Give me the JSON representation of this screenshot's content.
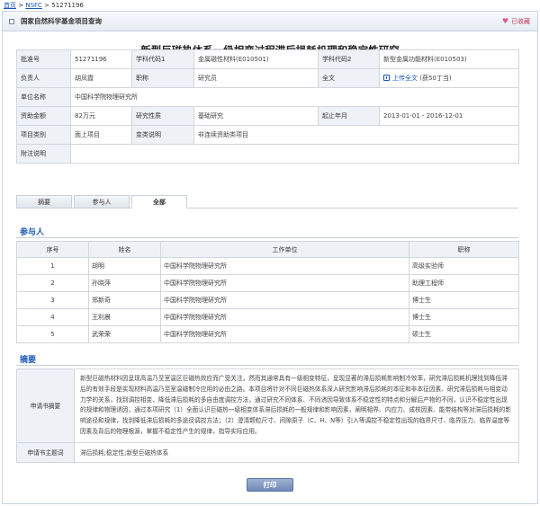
{
  "breadcrumb": {
    "home": "首页",
    "sep1": " > ",
    "nsfc": "NSFC",
    "sep2": " > ",
    "current": "51271196"
  },
  "header": {
    "title": "国家自然科学基金项目查询",
    "favorite": "已收藏",
    "favorite_icon": "heart-icon"
  },
  "page_title": "新型巨磁热体系一级相变过程滞后损耗机理和稳定性研究",
  "info": {
    "approval_no_label": "批准号",
    "approval_no": "51271196",
    "subject_code1_label": "学科代码1",
    "subject_code1": "金属磁性材料(E010501)",
    "subject_code2_label": "学科代码2",
    "subject_code2": "新型金属功能材料(E010503)",
    "leader_label": "负责人",
    "leader": "胡凤霞",
    "title_label": "职称",
    "title": "研究员",
    "fulltext_label": "全文",
    "fulltext_link": "上传全文",
    "fulltext_reward": "(获50丁当)",
    "unit_label": "单位名称",
    "unit": "中国科学院物理研究所",
    "funding_label": "资助金额",
    "funding": "82万元",
    "nature_label": "研究性质",
    "nature": "基础研究",
    "period_label": "起止年月",
    "period": "2013-01-01 - 2016-12-01",
    "category_label": "项目类别",
    "category": "面上项目",
    "change_label": "变类说明",
    "change": "非连续资助类项目",
    "note_label": "附注说明",
    "note": ""
  },
  "tabs": [
    {
      "label": "摘要"
    },
    {
      "label": "参与人"
    },
    {
      "label": "全部"
    }
  ],
  "participants": {
    "section_title": "参与人",
    "headers": [
      "序号",
      "姓名",
      "工作单位",
      "职称"
    ],
    "rows": [
      {
        "no": "1",
        "name": "胡明",
        "unit": "中国科学院物理研究所",
        "title": "高级实验师"
      },
      {
        "no": "2",
        "name": "孙晓萍",
        "unit": "中国科学院物理研究所",
        "title": "助理工程师"
      },
      {
        "no": "3",
        "name": "郑新奇",
        "unit": "中国科学院物理研究所",
        "title": "博士生"
      },
      {
        "no": "4",
        "name": "王利晨",
        "unit": "中国科学院物理研究所",
        "title": "博士生"
      },
      {
        "no": "5",
        "name": "武荣荣",
        "unit": "中国科学院物理研究所",
        "title": "硕士生"
      }
    ]
  },
  "abstract": {
    "section_title": "摘要",
    "summary_label": "申请书摘要",
    "summary": "新型巨磁热材料因呈现高温乃至室温区巨磁热效应而广受关注，然而其通常具有一级相变特征，呈现显著的滞后损耗影响制冷效率，研究滞后损耗机理找到降低滞后的有效手段是实现材料高温乃至室温磁制冷应用的必由之路。本项目将针对不同巨磁热体系深入研究影响滞后损耗的本征和非本征因素、研究滞后损耗与相变动力学的关系，找到调控相变、降低滞后损耗的多自由度调控方法，通过研究不同体系、不同诱因导致体系不稳定性的特点和分解后产物的不同，认识不稳定性出现的规律和物理诱因，通过本项研究（1）全面认识巨磁热一级相变体系滞后损耗的一般规律和影响因素，阐明相界、内应力、成核因素、能带结构等对滞后损耗的影响途径和规律，找到降低滞后损耗的多途径调控方法；（2）澄清颗粒尺寸、间隙原子（C、H、N等）引入等调控不稳定性出现的临界尺寸、临界压力、临界温度等因素及背后的物理根源，掌握不稳定性产生的规律，指导实际应用。",
    "keywords_label": "申请书主题词",
    "keywords": "滞后损耗;稳定性;新型巨磁热体系"
  },
  "print_button": "打印"
}
